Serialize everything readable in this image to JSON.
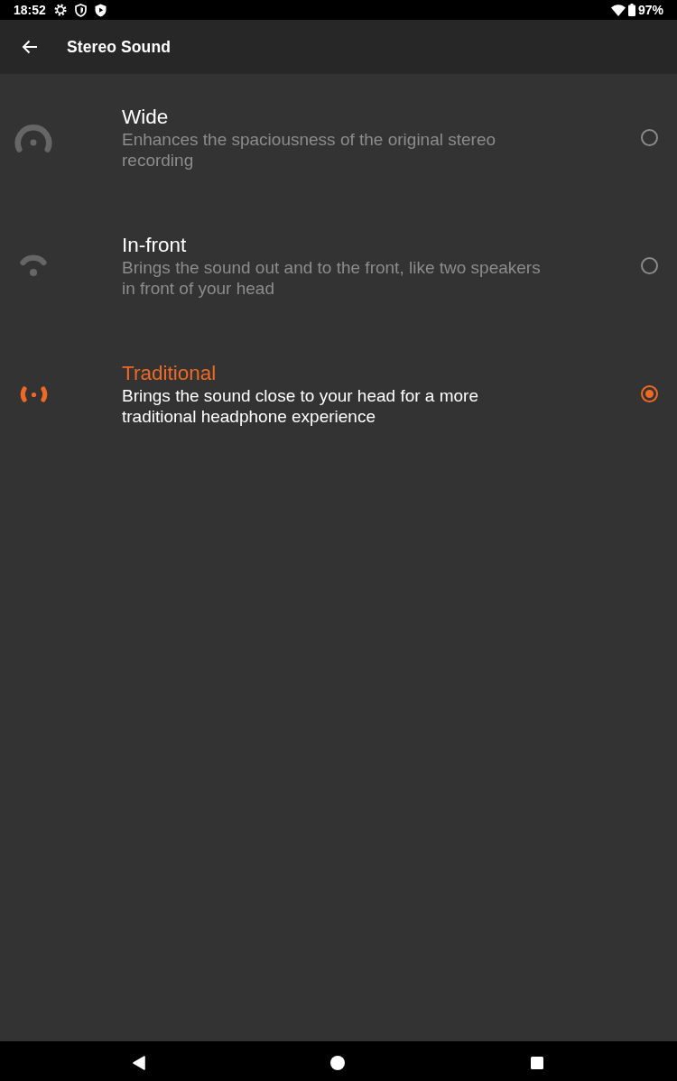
{
  "status_bar": {
    "time": "18:52",
    "battery": "97%"
  },
  "app_bar": {
    "title": "Stereo Sound"
  },
  "options": [
    {
      "kind": "wide",
      "title": "Wide",
      "description": "Enhances the spaciousness of the original stereo recording",
      "selected": false
    },
    {
      "kind": "front",
      "title": "In-front",
      "description": "Brings the sound out and to the front, like two speakers in front of your head",
      "selected": false
    },
    {
      "kind": "traditional",
      "title": "Traditional",
      "description": "Brings the sound close to your head for a more traditional headphone experience",
      "selected": true
    }
  ]
}
